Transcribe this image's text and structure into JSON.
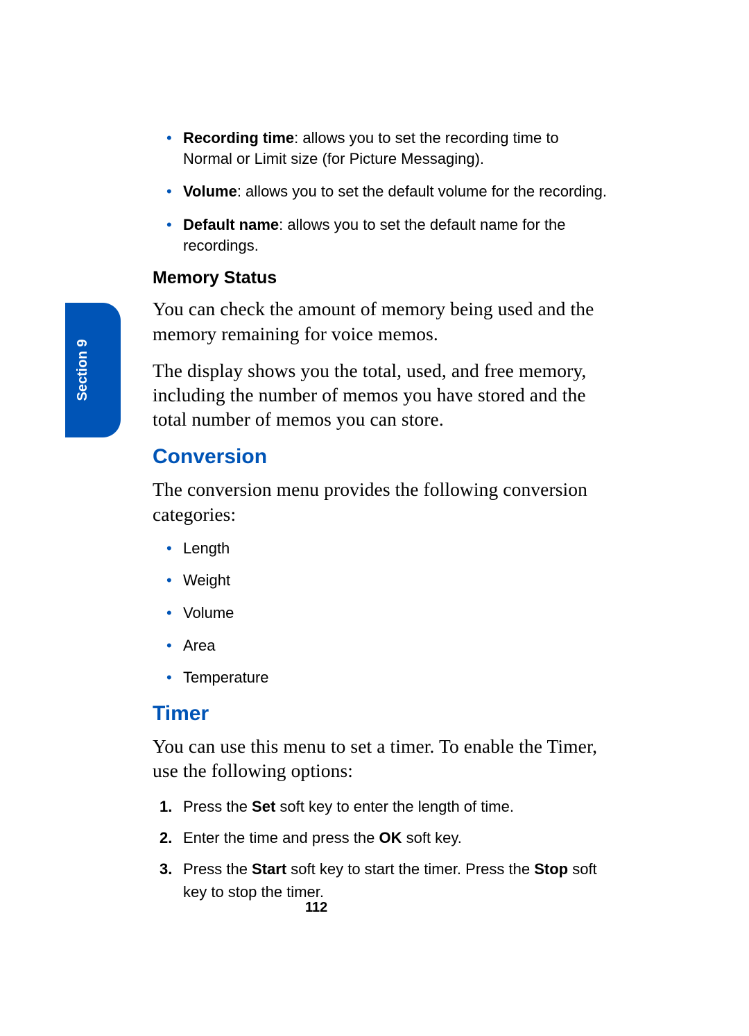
{
  "section_tab": "Section 9",
  "settings_bullets": [
    {
      "label": "Recording time",
      "text": ": allows you to set the recording time to Normal or Limit size (for Picture Messaging)."
    },
    {
      "label": "Volume",
      "text": ": allows you to set the default volume for the recording."
    },
    {
      "label": "Default name",
      "text": ": allows you to set the default name for the recordings."
    }
  ],
  "memory_status": {
    "heading": "Memory Status",
    "p1": "You can check the amount of memory being used and the memory remaining for voice memos.",
    "p2": "The display shows you the total, used, and free memory, including the number of memos you have stored and the total number of memos you can store."
  },
  "conversion": {
    "heading": "Conversion",
    "intro": "The conversion menu provides the following conversion categories:",
    "items": [
      "Length",
      "Weight",
      "Volume",
      "Area",
      "Temperature"
    ]
  },
  "timer": {
    "heading": "Timer",
    "intro": "You can use this menu to set a timer. To enable the Timer, use the following options:",
    "steps": [
      {
        "pre": "Press the ",
        "b1": "Set",
        "mid": " soft key to enter the length of time.",
        "b2": "",
        "post": ""
      },
      {
        "pre": "Enter the time and press the ",
        "b1": "OK",
        "mid": " soft key.",
        "b2": "",
        "post": ""
      },
      {
        "pre": "Press the ",
        "b1": "Start",
        "mid": " soft key to start the timer. Press the ",
        "b2": "Stop",
        "post": " soft key to stop the timer."
      }
    ]
  },
  "page_number": "112"
}
